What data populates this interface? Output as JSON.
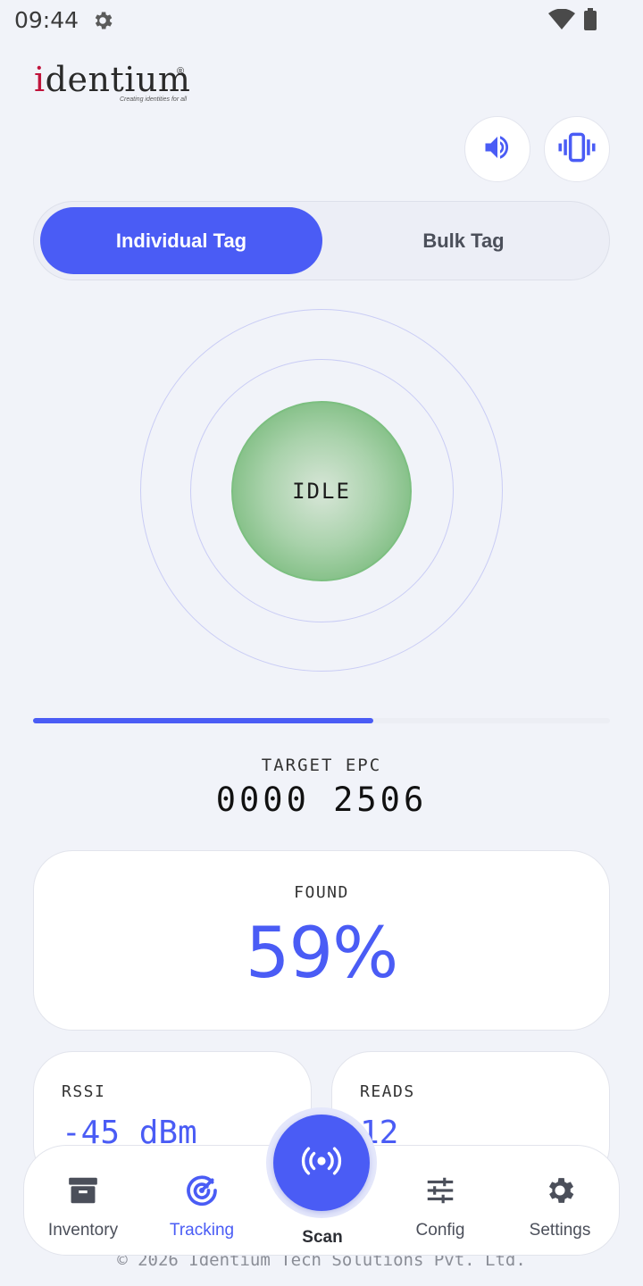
{
  "status_bar": {
    "time": "09:44",
    "icons": [
      "gear-icon",
      "wifi-icon",
      "battery-icon"
    ]
  },
  "header": {
    "logo_text_prefix": "i",
    "logo_text_rest": "dentium",
    "logo_registered": "®",
    "logo_tagline": "Creating identities for all",
    "sound_button_icon": "volume-icon",
    "vibrate_button_icon": "vibrate-icon"
  },
  "segment": {
    "active_label": "Individual Tag",
    "inactive_label": "Bulk Tag"
  },
  "radar": {
    "state": "IDLE"
  },
  "progress": {
    "fraction": 0.59
  },
  "target": {
    "label": "TARGET EPC",
    "value": "0000 2506"
  },
  "found": {
    "label": "FOUND",
    "value": "59%"
  },
  "rssi": {
    "label": "RSSI",
    "value": "-45 dBm"
  },
  "reads": {
    "label": "READS",
    "value": "12"
  },
  "nav": {
    "items": [
      {
        "label": "Inventory",
        "icon": "archive-icon"
      },
      {
        "label": "Tracking",
        "icon": "radar-icon",
        "active": true
      },
      {
        "label": "Scan",
        "icon": "scan-broadcast-icon"
      },
      {
        "label": "Config",
        "icon": "sliders-icon"
      },
      {
        "label": "Settings",
        "icon": "gear-icon"
      }
    ]
  },
  "footer": {
    "text": "© 2026 Identium Tech Solutions Pvt. Ltd."
  },
  "colors": {
    "accent": "#4a5cf5",
    "background": "#f1f3f9",
    "idle_orb": "#7cbc7f"
  }
}
